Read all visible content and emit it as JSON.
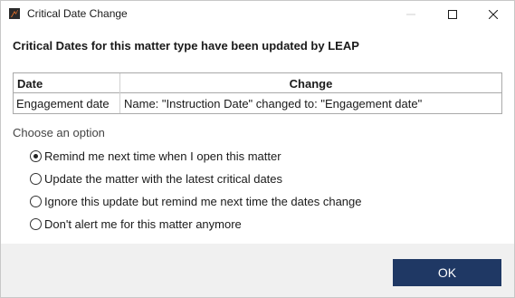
{
  "window": {
    "title": "Critical Date Change",
    "icon": "leap-app-icon"
  },
  "heading": "Critical Dates for this matter type have been updated by LEAP",
  "table": {
    "columns": [
      "Date",
      "Change"
    ],
    "rows": [
      [
        "Engagement date",
        "Name: \"Instruction Date\" changed to: \"Engagement date\""
      ]
    ]
  },
  "options": {
    "label": "Choose an option",
    "items": [
      {
        "label": "Remind me next time when I open this matter",
        "selected": true
      },
      {
        "label": "Update the matter with the latest critical dates",
        "selected": false
      },
      {
        "label": "Ignore this update but remind me next time the dates change",
        "selected": false
      },
      {
        "label": "Don't alert me for this matter anymore",
        "selected": false
      }
    ]
  },
  "buttons": {
    "ok": "OK"
  },
  "colors": {
    "accent": "#1f3864",
    "footer_bg": "#f0f0f0",
    "app_icon": "#e8702a"
  }
}
